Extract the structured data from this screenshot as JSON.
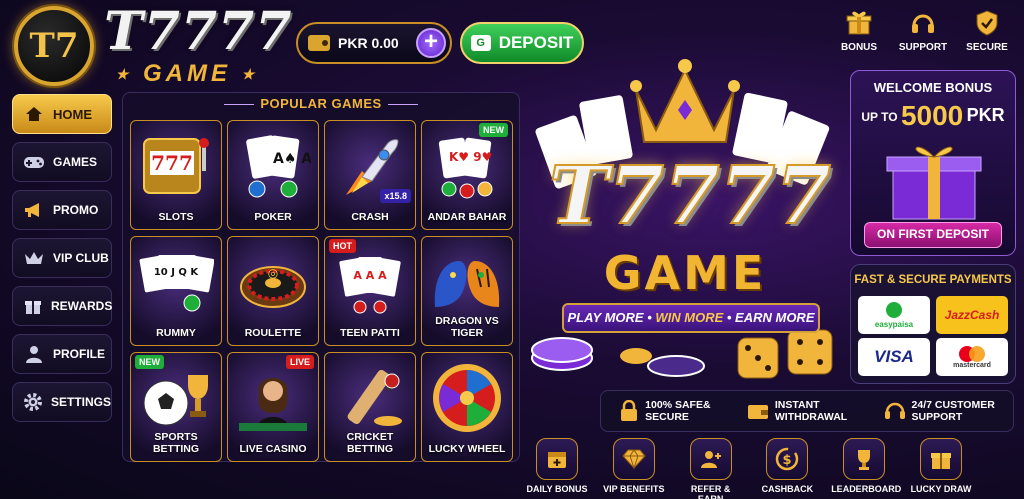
{
  "brand": {
    "badge": "T7",
    "title": "T7777",
    "subtitle": "GAME"
  },
  "wallet": {
    "currency": "PKR",
    "balance": "0.00",
    "add": "+"
  },
  "deposit": {
    "label": "DEPOSIT",
    "icon_text": "G"
  },
  "top_icons": [
    {
      "label": "BONUS",
      "icon": "gift-icon"
    },
    {
      "label": "SUPPORT",
      "icon": "headset-icon"
    },
    {
      "label": "SECURE",
      "icon": "shield-check-icon"
    }
  ],
  "sidebar": {
    "items": [
      {
        "label": "HOME",
        "icon": "home-icon",
        "active": true
      },
      {
        "label": "GAMES",
        "icon": "gamepad-icon"
      },
      {
        "label": "PROMO",
        "icon": "megaphone-icon"
      },
      {
        "label": "VIP CLUB",
        "icon": "crown-icon"
      },
      {
        "label": "REWARDS",
        "icon": "gift-icon"
      },
      {
        "label": "PROFILE",
        "icon": "user-icon"
      },
      {
        "label": "SETTINGS",
        "icon": "gear-icon"
      }
    ]
  },
  "popular": {
    "title": "POPULAR GAMES",
    "games": [
      {
        "label": "SLOTS",
        "art": "777",
        "badge": ""
      },
      {
        "label": "POKER",
        "art": "A♠ A♥",
        "badge": ""
      },
      {
        "label": "CRASH",
        "art": "🚀",
        "badge": "x15.8"
      },
      {
        "label": "ANDAR BAHAR",
        "art": "K♥ 9♥",
        "badge": "NEW"
      },
      {
        "label": "RUMMY",
        "art": "10 J Q K",
        "badge": ""
      },
      {
        "label": "ROULETTE",
        "art": "◎",
        "badge": ""
      },
      {
        "label": "TEEN PATTI",
        "art": "A A A",
        "badge": "HOT"
      },
      {
        "label": "DRAGON VS TIGER",
        "art": "🐉🐯",
        "badge": ""
      },
      {
        "label": "SPORTS BETTING",
        "art": "⚽🏆",
        "badge": "NEW"
      },
      {
        "label": "LIVE CASINO",
        "art": "👩",
        "badge": "LIVE"
      },
      {
        "label": "CRICKET BETTING",
        "art": "🏏",
        "badge": ""
      },
      {
        "label": "LUCKY WHEEL",
        "art": "☸",
        "badge": ""
      }
    ]
  },
  "hero": {
    "title": "T7777",
    "subtitle": "GAME",
    "tagline": {
      "a": "PLAY MORE",
      "sep1": " • ",
      "b": "WIN MORE",
      "sep2": " • ",
      "c": "EARN MORE"
    }
  },
  "welcome": {
    "title": "WELCOME BONUS",
    "prefix": "UP TO",
    "amount": "5000",
    "currency": "PKR",
    "cta": "ON FIRST DEPOSIT"
  },
  "payments": {
    "title": "FAST & SECURE PAYMENTS",
    "methods": [
      {
        "name": "easypaisa",
        "color": "#1fae3a"
      },
      {
        "name": "JazzCash",
        "color": "#d61d1d"
      },
      {
        "name": "VISA",
        "color": "#1a2a8a"
      },
      {
        "name": "mastercard",
        "color": "#333333"
      }
    ]
  },
  "features": [
    {
      "line1": "100% SAFE&",
      "line2": "SECURE",
      "icon": "lock-icon"
    },
    {
      "line1": "INSTANT",
      "line2": "WITHDRAWAL",
      "icon": "wallet-icon"
    },
    {
      "line1": "24/7 CUSTOMER",
      "line2": "SUPPORT",
      "icon": "headset-icon"
    }
  ],
  "actions": [
    {
      "label": "DAILY BONUS",
      "icon": "calendar-plus-icon"
    },
    {
      "label": "VIP BENEFITS",
      "icon": "diamond-icon"
    },
    {
      "label": "REFER & EARN",
      "icon": "user-plus-icon"
    },
    {
      "label": "CASHBACK",
      "icon": "cashback-icon"
    },
    {
      "label": "LEADERBOARD",
      "icon": "trophy-icon"
    },
    {
      "label": "LUCKY DRAW",
      "icon": "gift-icon"
    }
  ],
  "colors": {
    "gold": "#f0b53a",
    "purple": "#5b22c9",
    "green": "#1fae3a",
    "red": "#d61d1d"
  }
}
